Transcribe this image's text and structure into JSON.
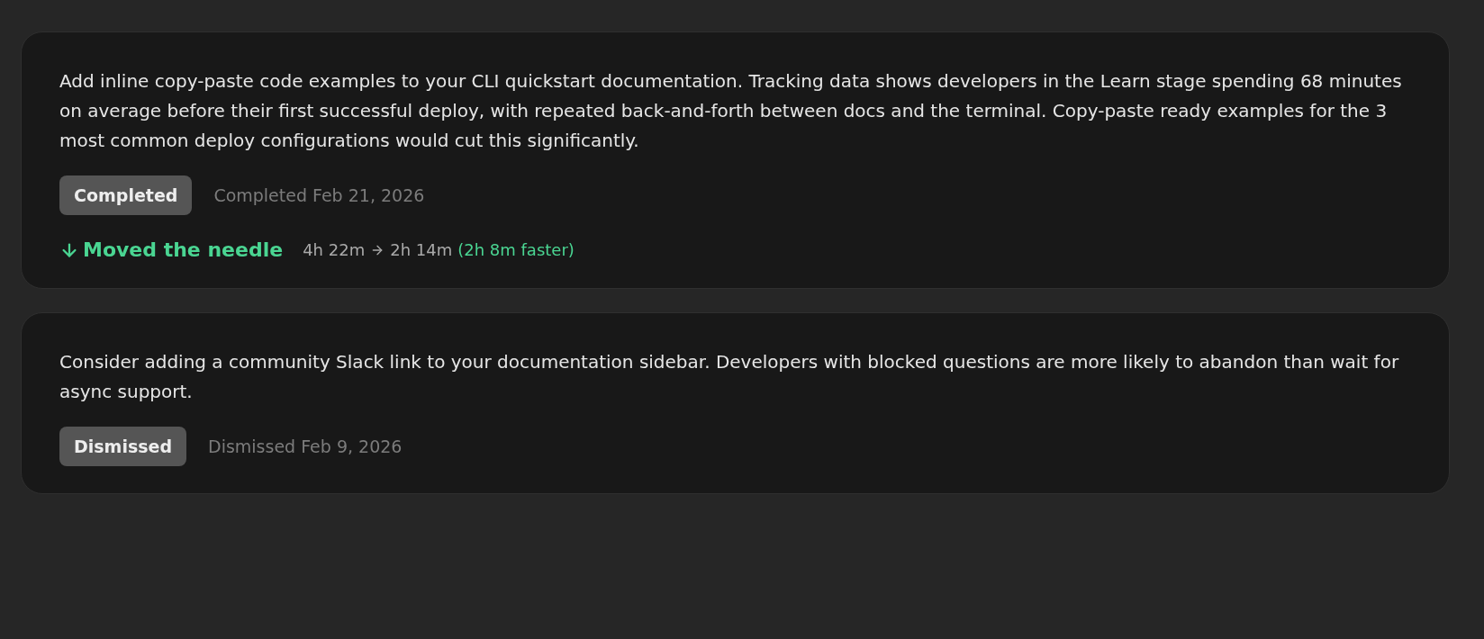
{
  "recommendations": [
    {
      "text": "Add inline copy-paste code examples to your CLI quickstart documentation. Tracking data shows developers in the Learn stage spending 68 minutes on average before their first successful deploy, with repeated back-and-forth between docs and the terminal. Copy-paste ready examples for the 3 most common deploy configurations would cut this significantly.",
      "status": "Completed",
      "status_note": "Completed Feb 21, 2026",
      "impact": {
        "label": "Moved the needle",
        "before": "4h 22m",
        "after": "2h 14m",
        "delta": "(2h 8m faster)"
      }
    },
    {
      "text": "Consider adding a community Slack link to your documentation sidebar. Developers with blocked questions are more likely to abandon than wait for async support.",
      "status": "Dismissed",
      "status_note": "Dismissed Feb 9, 2026"
    }
  ]
}
